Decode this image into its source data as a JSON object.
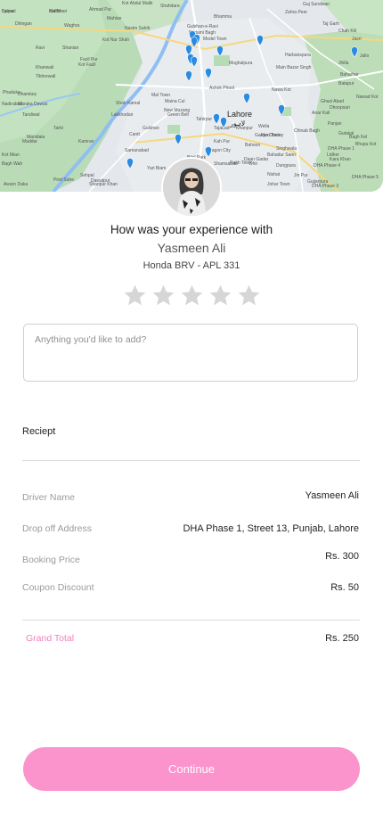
{
  "map": {
    "city_label": "Lahore",
    "city_label_urdu": "لاہور",
    "place_labels": [
      "Lalpur",
      "Malho",
      "Dhingan",
      "Waghra",
      "Mahlan",
      "Ahmad Pur",
      "Kot Abdul Malik",
      "Shahdara",
      "Nasim Sahib",
      "Bhamma",
      "Zahra Peer",
      "Guj Sundwan",
      "Taj Garh",
      "Jallo",
      "Chah Kili",
      "Jasri",
      "Ravi",
      "Kot Nur Shah",
      "Fazil Pur",
      "Kot Fazil",
      "Khanwali",
      "Tikhrewall",
      "Shanian",
      "Phaduka",
      "Dhamkey",
      "Gulshan-e-Ravi",
      "Badami Bagh",
      "Mughalpura",
      "Main Bazar Singh",
      "Harbanspura",
      "Batapur",
      "Tandiwal",
      "Tarbi",
      "Kamran",
      "Lakkhodair",
      "New Muzang",
      "Mal Town",
      "Nawa Kot",
      "Ghazi Abad",
      "Panjan",
      "Dhoopsari",
      "Gutakal",
      "Paragon City",
      "Shamsabad",
      "Samanabad",
      "Cantt",
      "Dhir",
      "Dungpura",
      "Singhwala",
      "Baharhar",
      "Nawad Kot",
      "Nadirabad",
      "Maraka Dawas",
      "Mandiala",
      "Maddar",
      "Kot Mian",
      "Bagh Wah",
      "Pind Sahe",
      "Sehpal",
      "Dawatpur",
      "Awarn Daka",
      "Sharipur Khan",
      "Bahadur Sarin",
      "Wella",
      "Yari Biam",
      "Tahirpur",
      "Khanpur",
      "Johar Town",
      "Gujjarpura",
      "DHA Phase 3",
      "DHA Phase 1",
      "Lidher",
      "Ashok Phool",
      "Maina Cul",
      "Tajabad",
      "Shah Kamal",
      "Green Belt",
      "Gulshan",
      "Model Town",
      "Garden Town",
      "Chinab Bagh",
      "Bagh Kel",
      "Bhupu Kot",
      "DHA Phase 4",
      "DHA Phase 5",
      "Kah Pur",
      "Bahoon",
      "Rakh Tetek",
      "Jiya Dhotey",
      "Daan Gadar",
      "Anar Kali",
      "Kara Khan",
      "Jhilla",
      "Bilal Park",
      "Nishat",
      "Jin Pur",
      "Tyewal",
      "Kal Bhari"
    ]
  },
  "rating": {
    "question": "How was your experience with",
    "driver_name": "Yasmeen Ali",
    "vehicle": "Honda BRV - APL 331",
    "stars_total": 5,
    "stars_selected": 0
  },
  "comment": {
    "placeholder": "Anything you'd like to add?",
    "value": ""
  },
  "receipt": {
    "title": "Reciept",
    "rows": [
      {
        "label": "Driver Name",
        "value": "Yasmeen Ali"
      },
      {
        "label": "Drop off Address",
        "value": "DHA Phase 1, Street 13, Punjab, Lahore"
      },
      {
        "label": "Booking Price",
        "value": "Rs. 300"
      },
      {
        "label": "Coupon Discount",
        "value": "Rs. 50"
      }
    ],
    "total_label": "Grand Total",
    "total_value": "Rs. 250"
  },
  "continue_label": "Continue",
  "colors": {
    "accent": "#fb93cd",
    "accent_text": "#f07fbd",
    "star_empty": "#d6d6d6",
    "map_pin": "#2a8be0",
    "park_green": "#b6dcb5",
    "river": "#8fbff2"
  }
}
